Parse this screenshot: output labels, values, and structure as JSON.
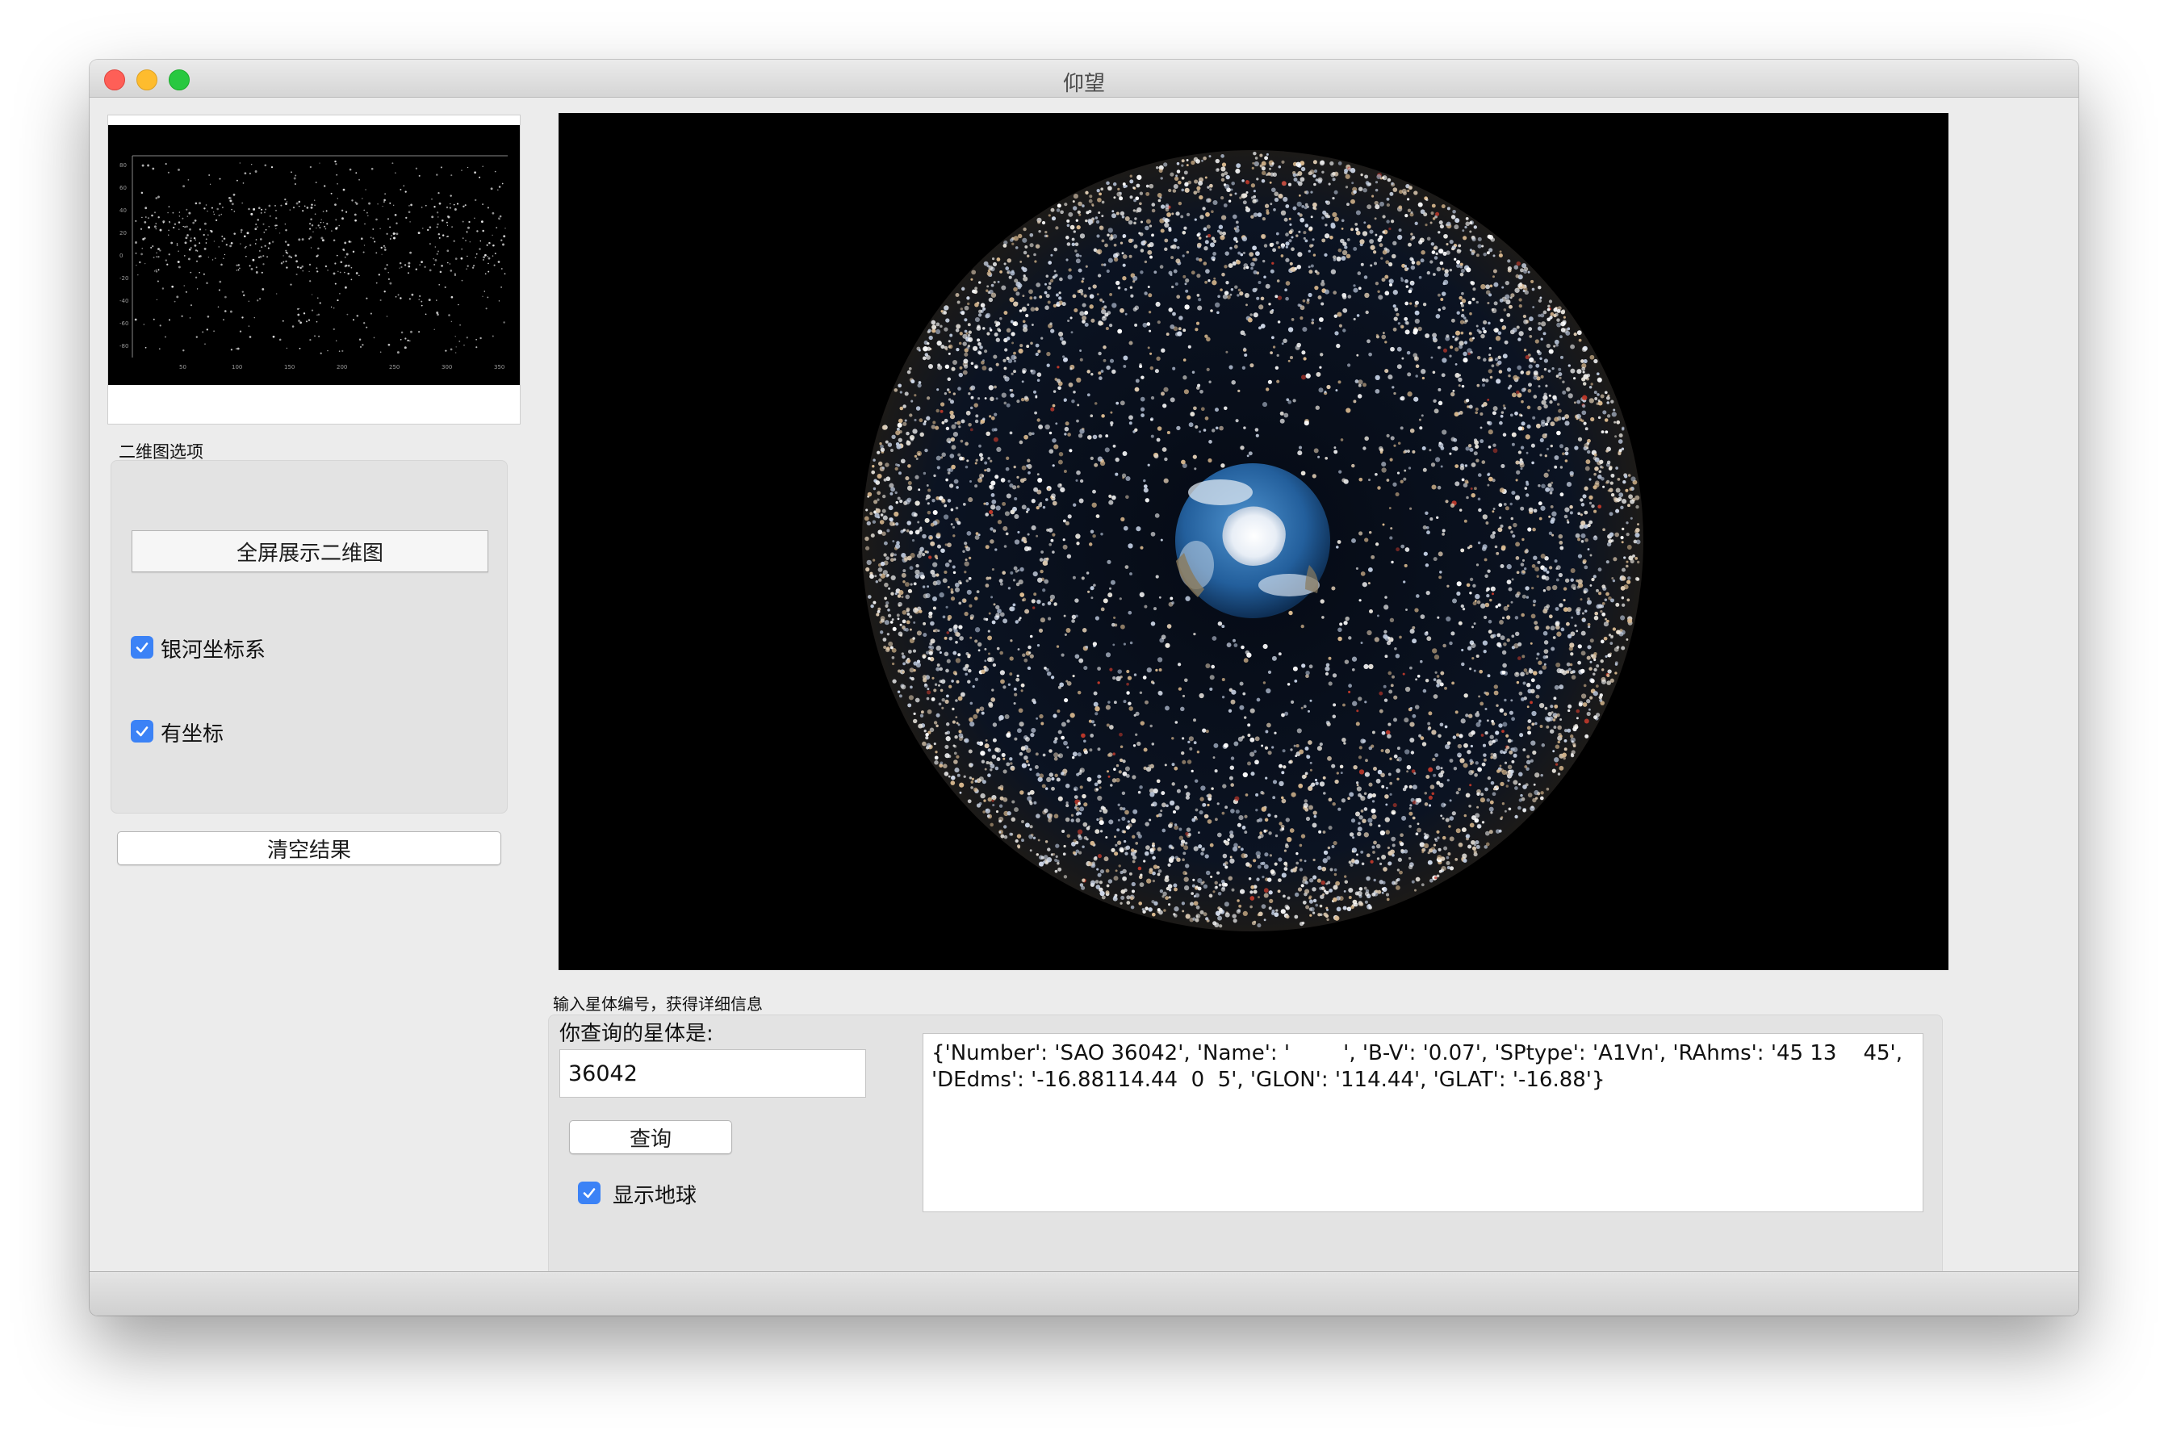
{
  "window": {
    "title": "仰望"
  },
  "preview": {
    "ytick_labels": [
      "80",
      "60",
      "40",
      "20",
      "0",
      "-20",
      "-40",
      "-60",
      "-80"
    ],
    "xtick_labels": [
      "50",
      "100",
      "150",
      "200",
      "250",
      "300",
      "350"
    ]
  },
  "options_group": {
    "title": "二维图选项"
  },
  "buttons": {
    "fullscreen_2d": "全屏展示二维图",
    "clear_results": "清空结果",
    "query": "查询"
  },
  "checkboxes": {
    "galactic_coords": {
      "label": "银河坐标系",
      "checked": true
    },
    "show_coords": {
      "label": "有坐标",
      "checked": true
    },
    "show_earth": {
      "label": "显示地球",
      "checked": true
    }
  },
  "query_section": {
    "caption": "输入星体编号，获得详细信息",
    "prompt": "你查询的星体是:",
    "input_value": "36042",
    "result_line1": "{'Number': 'SAO 36042', 'Name': '        ', 'B-V': '0.07', 'SPtype': 'A1Vn', 'RAhms': '45 13    45',",
    "result_line2": "'DEdms': '-16.88114.44  0  5', 'GLON': '114.44', 'GLAT': '-16.88'}"
  },
  "colors": {
    "accent": "#3b82f6",
    "viewport_bg": "#000000",
    "ocean": "#2a6fb0",
    "ice": "#f2f6fb"
  }
}
